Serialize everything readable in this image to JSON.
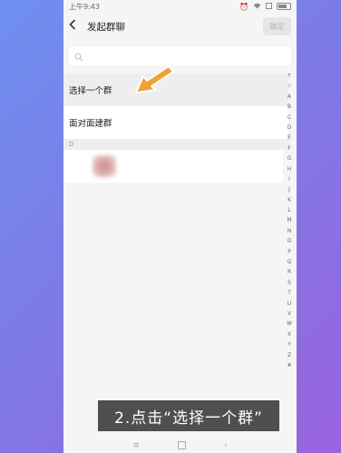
{
  "status_bar": {
    "time": "上午9:43"
  },
  "header": {
    "title": "发起群聊",
    "confirm_label": "确定"
  },
  "list": {
    "items": [
      {
        "label": "选择一个群"
      },
      {
        "label": "面对面建群"
      }
    ],
    "section_letter": "D"
  },
  "index_bar": {
    "letters": [
      "↑",
      "☆",
      "A",
      "B",
      "C",
      "D",
      "E",
      "F",
      "G",
      "H",
      "I",
      "J",
      "K",
      "L",
      "M",
      "N",
      "O",
      "P",
      "Q",
      "R",
      "S",
      "T",
      "U",
      "V",
      "W",
      "X",
      "Y",
      "Z",
      "#"
    ]
  },
  "caption": {
    "text": "2.点击“选择一个群”"
  },
  "colors": {
    "arrow": "#f0a13c",
    "caption_bg": "#4f4f4f"
  },
  "icons": [
    "back-icon",
    "search-icon",
    "alarm-icon",
    "wifi-icon",
    "sim-icon",
    "battery-icon",
    "arrow-icon",
    "nav-menu-icon",
    "nav-home-icon",
    "nav-back-icon"
  ]
}
